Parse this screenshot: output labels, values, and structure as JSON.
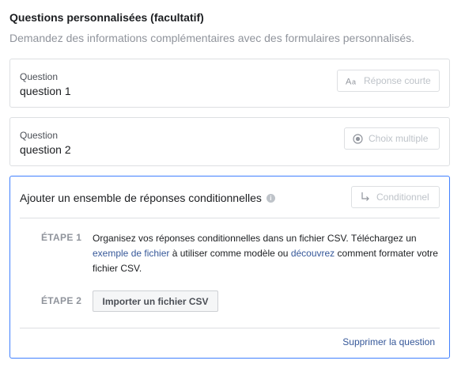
{
  "header": {
    "title": "Questions personnalisées (facultatif)",
    "subtitle": "Demandez des informations complémentaires avec des formulaires personnalisés."
  },
  "questions": [
    {
      "label": "Question",
      "value": "question 1",
      "type_label": "Réponse courte",
      "type_icon": "text-aa-icon"
    },
    {
      "label": "Question",
      "value": "question 2",
      "type_label": "Choix multiple",
      "type_icon": "radio-icon"
    }
  ],
  "conditional": {
    "title": "Ajouter un ensemble de réponses conditionnelles",
    "info_icon": "info-icon",
    "type_label": "Conditionnel",
    "type_icon": "branch-arrow-icon",
    "step1": {
      "label": "ÉTAPE 1",
      "text_before": "Organisez vos réponses conditionnelles dans un fichier CSV. Téléchargez un",
      "link1": "exemple de fichier",
      "text_middle": "à utiliser comme modèle ou",
      "link2": "découvrez",
      "text_after": "comment formater votre fichier CSV."
    },
    "step2": {
      "label": "ÉTAPE 2",
      "button": "Importer un fichier CSV"
    },
    "delete_link": "Supprimer la question"
  },
  "colors": {
    "accent_border": "#4080ff",
    "link": "#365899",
    "muted": "#90949c"
  }
}
